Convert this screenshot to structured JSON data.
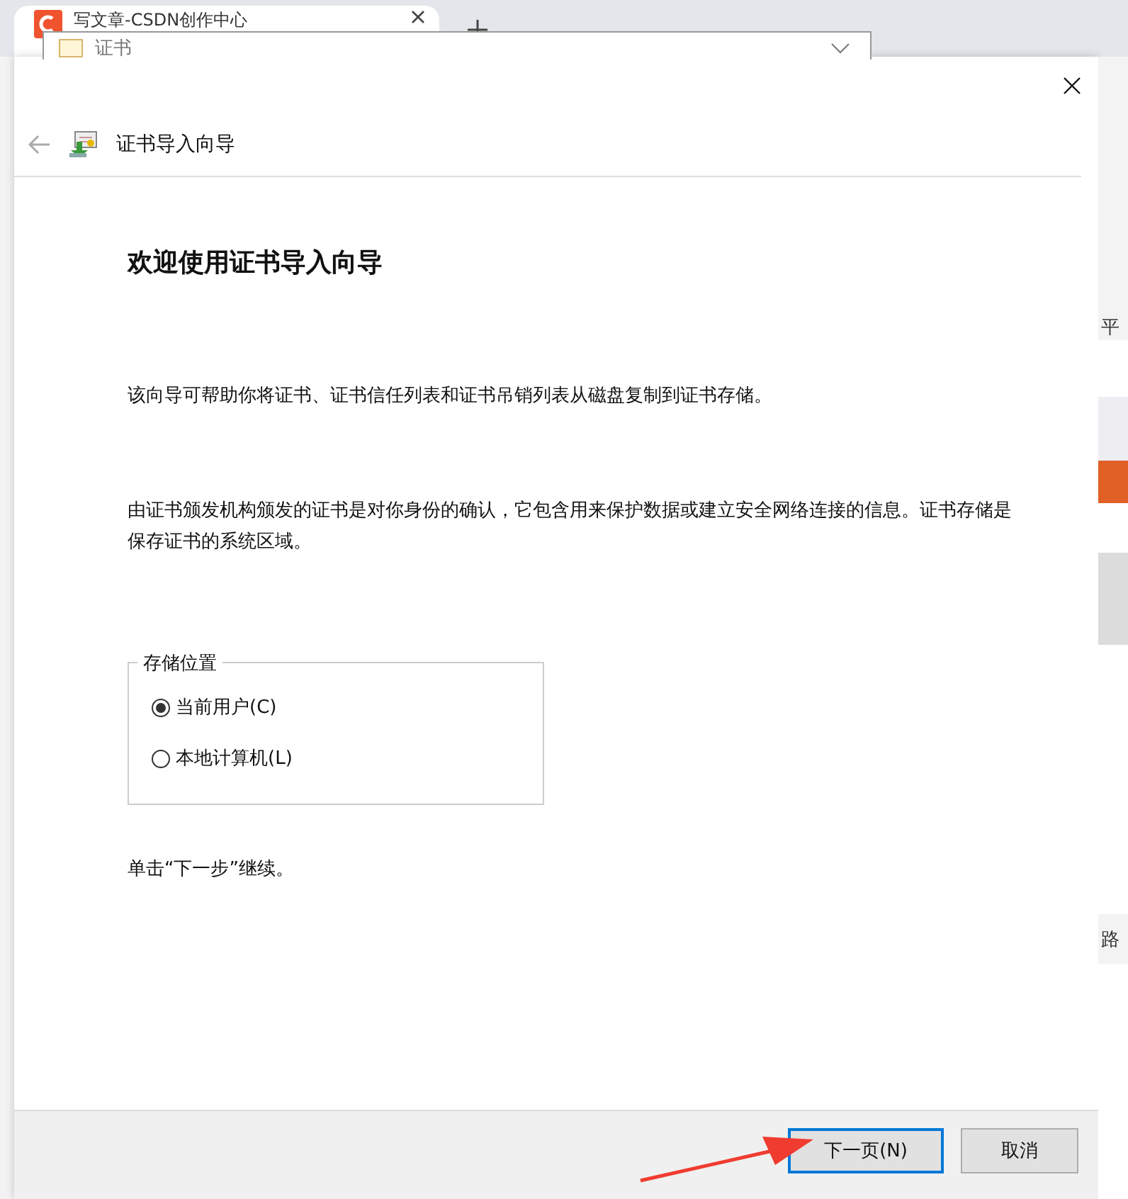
{
  "browser_tab": {
    "title": "写文章-CSDN创作中心"
  },
  "background_window": {
    "title": "证书"
  },
  "dialog": {
    "title": "证书导入向导",
    "heading": "欢迎使用证书导入向导",
    "paragraphs": [
      "该向导可帮助你将证书、证书信任列表和证书吊销列表从磁盘复制到证书存储。",
      "由证书颁发机构颁发的证书是对你身份的确认，它包含用来保护数据或建立安全网络连接的信息。证书存储是保存证书的系统区域。"
    ],
    "store_location": {
      "legend": "存储位置",
      "options": [
        {
          "label": "当前用户(C)",
          "selected": true
        },
        {
          "label": "本地计算机(L)",
          "selected": false
        }
      ]
    },
    "hint": "单击“下一步”继续。",
    "buttons": [
      {
        "label": "下一页(N)",
        "default": true
      },
      {
        "label": "取消",
        "default": false
      }
    ]
  },
  "background_page": {
    "fragments": [
      "平",
      "路"
    ]
  }
}
